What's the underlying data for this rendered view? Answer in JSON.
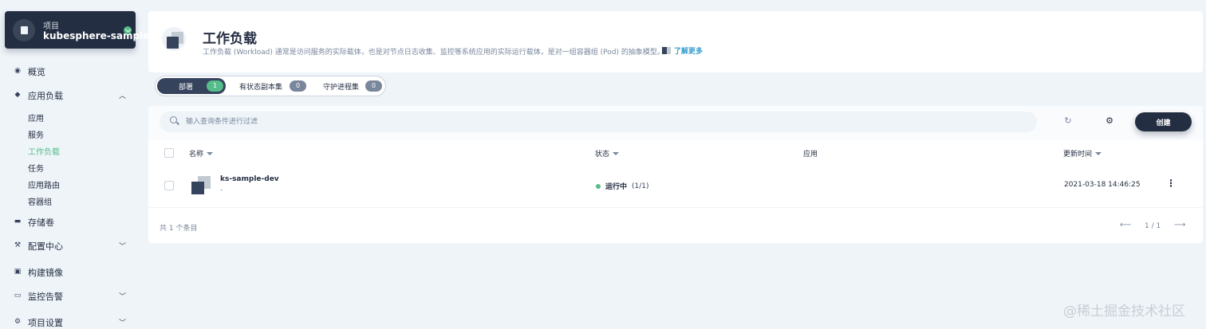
{
  "sidebar": {
    "project_label": "项目",
    "project_name": "kubesphere-sample...",
    "items": [
      {
        "label": "概览",
        "icon": "overview-icon"
      },
      {
        "label": "应用负载",
        "icon": "layers-icon",
        "expanded": true
      },
      {
        "label": "存储卷",
        "icon": "storage-icon"
      },
      {
        "label": "配置中心",
        "icon": "hammer-icon"
      },
      {
        "label": "构建镜像",
        "icon": "build-icon"
      },
      {
        "label": "监控告警",
        "icon": "monitor-icon"
      },
      {
        "label": "项目设置",
        "icon": "gear-icon"
      }
    ],
    "sub_items": [
      "应用",
      "服务",
      "工作负载",
      "任务",
      "应用路由",
      "容器组"
    ],
    "active_sub": "工作负载"
  },
  "header": {
    "title": "工作负载",
    "description": "工作负载 (Workload) 通常是访问服务的实际载体，也是对节点日志收集、监控等系统应用的实际运行载体，是对一组容器组 (Pod) 的抽象模型。",
    "learn_more": "了解更多"
  },
  "tabs": [
    {
      "label": "部署",
      "count": "1",
      "active": true
    },
    {
      "label": "有状态副本集",
      "count": "0",
      "active": false
    },
    {
      "label": "守护进程集",
      "count": "0",
      "active": false
    }
  ],
  "toolbar": {
    "search_placeholder": "输入查询条件进行过滤",
    "create_label": "创建"
  },
  "table": {
    "columns": [
      "名称",
      "状态",
      "应用",
      "更新时间"
    ],
    "rows": [
      {
        "name": "ks-sample-dev",
        "sub": "-",
        "status": "运行中",
        "status_count": "(1/1)",
        "app": "",
        "updated": "2021-03-18 14:46:25"
      }
    ]
  },
  "footer": {
    "total": "共 1 个条目",
    "page": "1 / 1"
  },
  "watermark": "@稀土掘金技术社区",
  "colors": {
    "accent": "#55bc8a",
    "dark": "#242e42",
    "link": "#329dce",
    "background": "#eff4f9"
  }
}
